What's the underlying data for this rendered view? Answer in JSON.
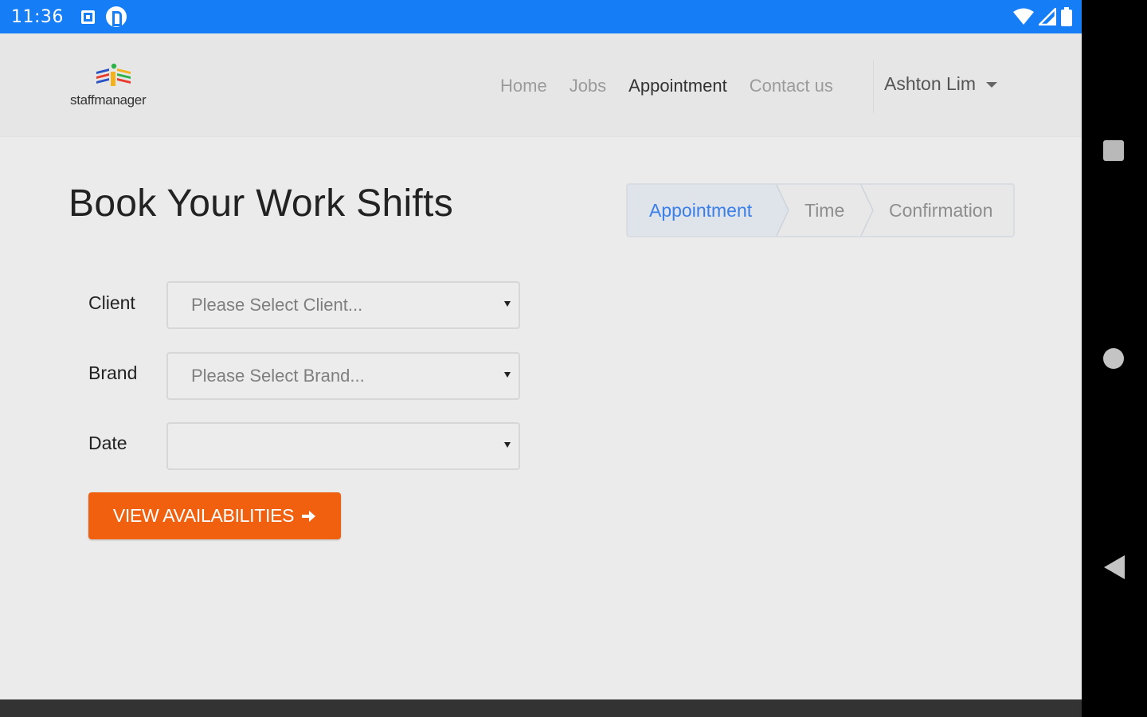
{
  "status_bar": {
    "time": "11:36"
  },
  "app": {
    "logo_text": "staffmanager",
    "nav": {
      "links": [
        "Home",
        "Jobs",
        "Appointment",
        "Contact us"
      ],
      "active_index": 2,
      "user_name": "Ashton Lim"
    },
    "page_title": "Book Your Work Shifts",
    "steps": [
      "Appointment",
      "Time",
      "Confirmation"
    ],
    "form": {
      "client_label": "Client",
      "client_placeholder": "Please Select Client...",
      "brand_label": "Brand",
      "brand_placeholder": "Please Select Brand...",
      "date_label": "Date",
      "date_value": ""
    },
    "view_button_label": "VIEW AVAILABILITIES",
    "colors": {
      "status_bar": "#157ef7",
      "accent_orange": "#f0600f",
      "active_step": "#3a7ee8"
    }
  }
}
